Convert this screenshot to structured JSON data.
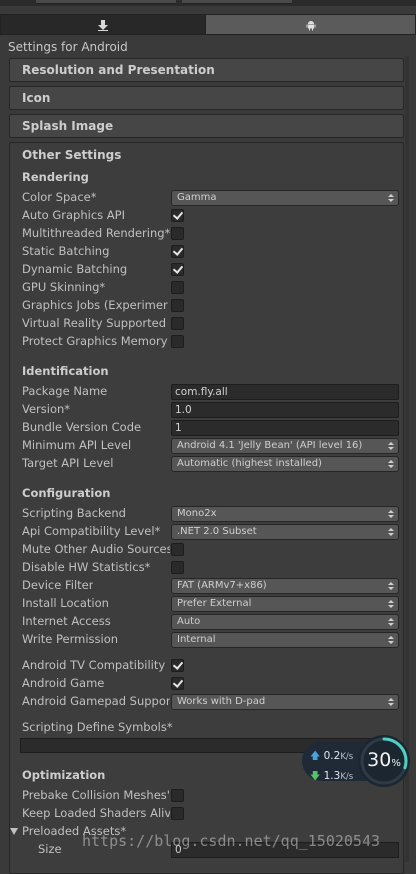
{
  "header": {
    "settings_title": "Settings for Android"
  },
  "tabs": [
    {
      "icon": "download-icon",
      "selected": false
    },
    {
      "icon": "android-icon",
      "selected": true
    }
  ],
  "sections": {
    "resolution": "Resolution and Presentation",
    "icon": "Icon",
    "splash": "Splash Image",
    "other": "Other Settings"
  },
  "rendering": {
    "header": "Rendering",
    "color_space": {
      "label": "Color Space*",
      "value": "Gamma"
    },
    "auto_graphics_api": {
      "label": "Auto Graphics API",
      "checked": true
    },
    "multithreaded_rendering": {
      "label": "Multithreaded Rendering*",
      "checked": false
    },
    "static_batching": {
      "label": "Static Batching",
      "checked": true
    },
    "dynamic_batching": {
      "label": "Dynamic Batching",
      "checked": true
    },
    "gpu_skinning": {
      "label": "GPU Skinning*",
      "checked": false
    },
    "graphics_jobs": {
      "label": "Graphics Jobs (Experimer",
      "checked": false
    },
    "virtual_reality": {
      "label": "Virtual Reality Supported",
      "checked": false
    },
    "protect_graphics_memory": {
      "label": "Protect Graphics Memory",
      "checked": false
    }
  },
  "identification": {
    "header": "Identification",
    "package_name": {
      "label": "Package Name",
      "value": "com.fly.all"
    },
    "version": {
      "label": "Version*",
      "value": "1.0"
    },
    "bundle_version_code": {
      "label": "Bundle Version Code",
      "value": "1"
    },
    "min_api": {
      "label": "Minimum API Level",
      "value": "Android 4.1 'Jelly Bean' (API level 16)"
    },
    "target_api": {
      "label": "Target API Level",
      "value": "Automatic (highest installed)"
    }
  },
  "configuration": {
    "header": "Configuration",
    "scripting_backend": {
      "label": "Scripting Backend",
      "value": "Mono2x"
    },
    "api_compat": {
      "label": "Api Compatibility Level*",
      "value": ".NET 2.0 Subset"
    },
    "mute_audio": {
      "label": "Mute Other Audio Sources",
      "checked": false
    },
    "disable_hw_stats": {
      "label": "Disable HW Statistics*",
      "checked": false
    },
    "device_filter": {
      "label": "Device Filter",
      "value": "FAT (ARMv7+x86)"
    },
    "install_location": {
      "label": "Install Location",
      "value": "Prefer External"
    },
    "internet_access": {
      "label": "Internet Access",
      "value": "Auto"
    },
    "write_permission": {
      "label": "Write Permission",
      "value": "Internal"
    },
    "android_tv": {
      "label": "Android TV Compatibility",
      "checked": true
    },
    "android_game": {
      "label": "Android Game",
      "checked": true
    },
    "gamepad_support": {
      "label": "Android Gamepad Suppor",
      "value": "Works with D-pad"
    },
    "scripting_define_symbols": {
      "label": "Scripting Define Symbols*"
    }
  },
  "optimization": {
    "header": "Optimization",
    "prebake_collision": {
      "label": "Prebake Collision Meshes'",
      "checked": false
    },
    "keep_loaded_shaders": {
      "label": "Keep Loaded Shaders Aliv",
      "checked": false
    },
    "preloaded_assets": {
      "label": "Preloaded Assets*"
    },
    "size": {
      "label": "Size",
      "value": "0"
    }
  },
  "overlay_widget": {
    "upload": "0.2",
    "download": "1.3",
    "unit": "K/s",
    "percent": "30",
    "percent_sign": "%",
    "fill": 0.3
  },
  "watermark": "https://blog.csdn.net/qq_15020543"
}
